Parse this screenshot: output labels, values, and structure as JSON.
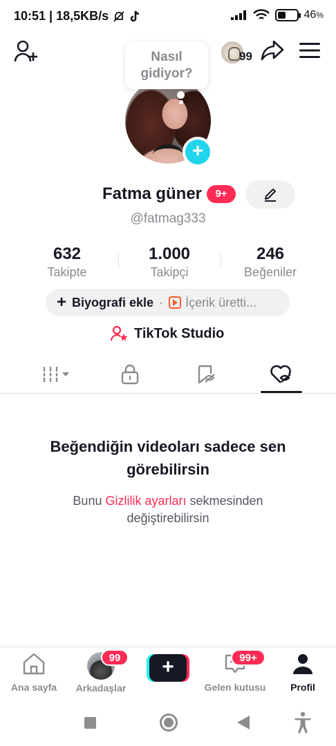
{
  "status_bar": {
    "time_speed": "10:51 | 18,5KB/s",
    "battery_pct": "46",
    "battery_unit": "%",
    "battery_level": 0.46
  },
  "top_bar": {
    "profile_views_count": "99"
  },
  "thought_bubble": {
    "line1": "Nasıl",
    "line2": "gidiyor?"
  },
  "profile": {
    "name": "Fatma güner",
    "name_badge": "9+",
    "handle": "@fatmag333"
  },
  "stats": [
    {
      "value": "632",
      "label": "Takipte"
    },
    {
      "value": "1.000",
      "label": "Takipçi"
    },
    {
      "value": "246",
      "label": "Beğeniler"
    }
  ],
  "bio": {
    "plus": "+",
    "add_label": "Biyografi ekle",
    "separator": "·",
    "content_label": "İçerik üretti..."
  },
  "studio": {
    "label": "TikTok Studio"
  },
  "empty_state": {
    "title_line1": "Beğendiğin videoları sadece sen",
    "title_line2": "görebilirsin",
    "sub_prefix": "Bunu ",
    "sub_link": "Gizlilik ayarları",
    "sub_mid": " sekmesinden",
    "sub_line2": "değiştirebilirsin"
  },
  "bottom_nav": {
    "home": "Ana sayfa",
    "friends": "Arkadaşlar",
    "friends_badge": "99",
    "create": "+",
    "inbox": "Gelen kutusu",
    "inbox_badge": "99+",
    "profile": "Profil"
  },
  "colors": {
    "accent": "#fe2c55",
    "cyan": "#20d5ec",
    "text": "#161823",
    "muted": "#8a8b91"
  }
}
